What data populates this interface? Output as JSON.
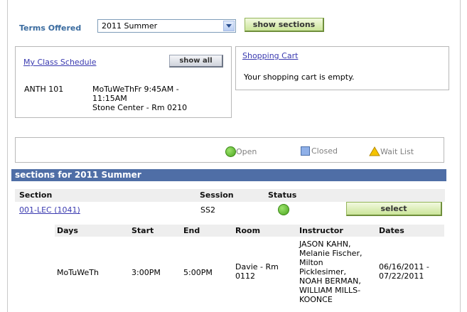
{
  "terms": {
    "label": "Terms Offered",
    "selected": "2011 Summer",
    "button": "show sections"
  },
  "schedule": {
    "link": "My Class Schedule",
    "show_all": "show all",
    "course": "ANTH 101",
    "meeting_line1": "MoTuWeThFr 9:45AM -",
    "meeting_line2": "11:15AM",
    "meeting_line3": "Stone Center - Rm 0210"
  },
  "cart": {
    "link": "Shopping Cart",
    "message": "Your shopping cart is empty."
  },
  "legend": {
    "open": "Open",
    "closed": "Closed",
    "wait": "Wait List"
  },
  "sections": {
    "header": "sections for 2011 Summer",
    "columns": {
      "section": "Section",
      "session": "Session",
      "status": "Status"
    },
    "row": {
      "section": "001-LEC (1041)",
      "session": "SS2",
      "status": "Open",
      "select": "select"
    },
    "meeting_columns": {
      "days": "Days",
      "start": "Start",
      "end": "End",
      "room": "Room",
      "instructor": "Instructor",
      "dates": "Dates"
    },
    "meeting": {
      "days": "MoTuWeTh",
      "start": "3:00PM",
      "end": "5:00PM",
      "room_line1": "Davie - Rm",
      "room_line2": "0112",
      "instructors": [
        "JASON KAHN,",
        "Melanie Fischer,",
        "Milton",
        "Picklesimer,",
        "NOAH BERMAN,",
        "WILLIAM MILLS-",
        "KOONCE"
      ],
      "dates_line1": "06/16/2011 -",
      "dates_line2": "07/22/2011"
    }
  },
  "colors": {
    "header_bg": "#4f6ea6",
    "label_blue": "#3a6b9f",
    "open_green": "#4ca520",
    "closed_blue": "#8fb0e8",
    "wait_yellow": "#f5c400"
  }
}
